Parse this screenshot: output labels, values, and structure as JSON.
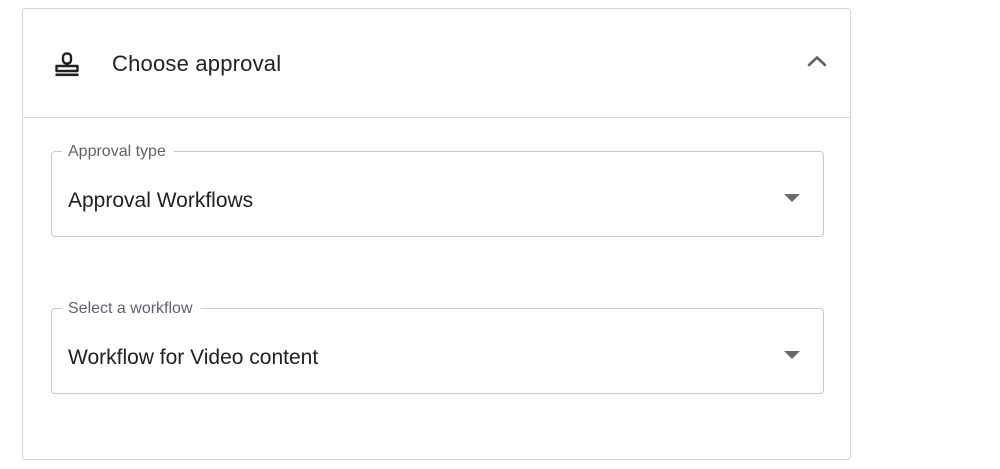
{
  "panel": {
    "title": "Choose approval",
    "header_icon": "stamp-icon",
    "toggle_icon": "chevron-up-icon"
  },
  "approval_type": {
    "label": "Approval type",
    "value": "Approval Workflows",
    "icon": "dropdown-arrow-icon"
  },
  "workflow": {
    "label": "Select a workflow",
    "value": "Workflow for Video content",
    "icon": "dropdown-arrow-icon"
  }
}
